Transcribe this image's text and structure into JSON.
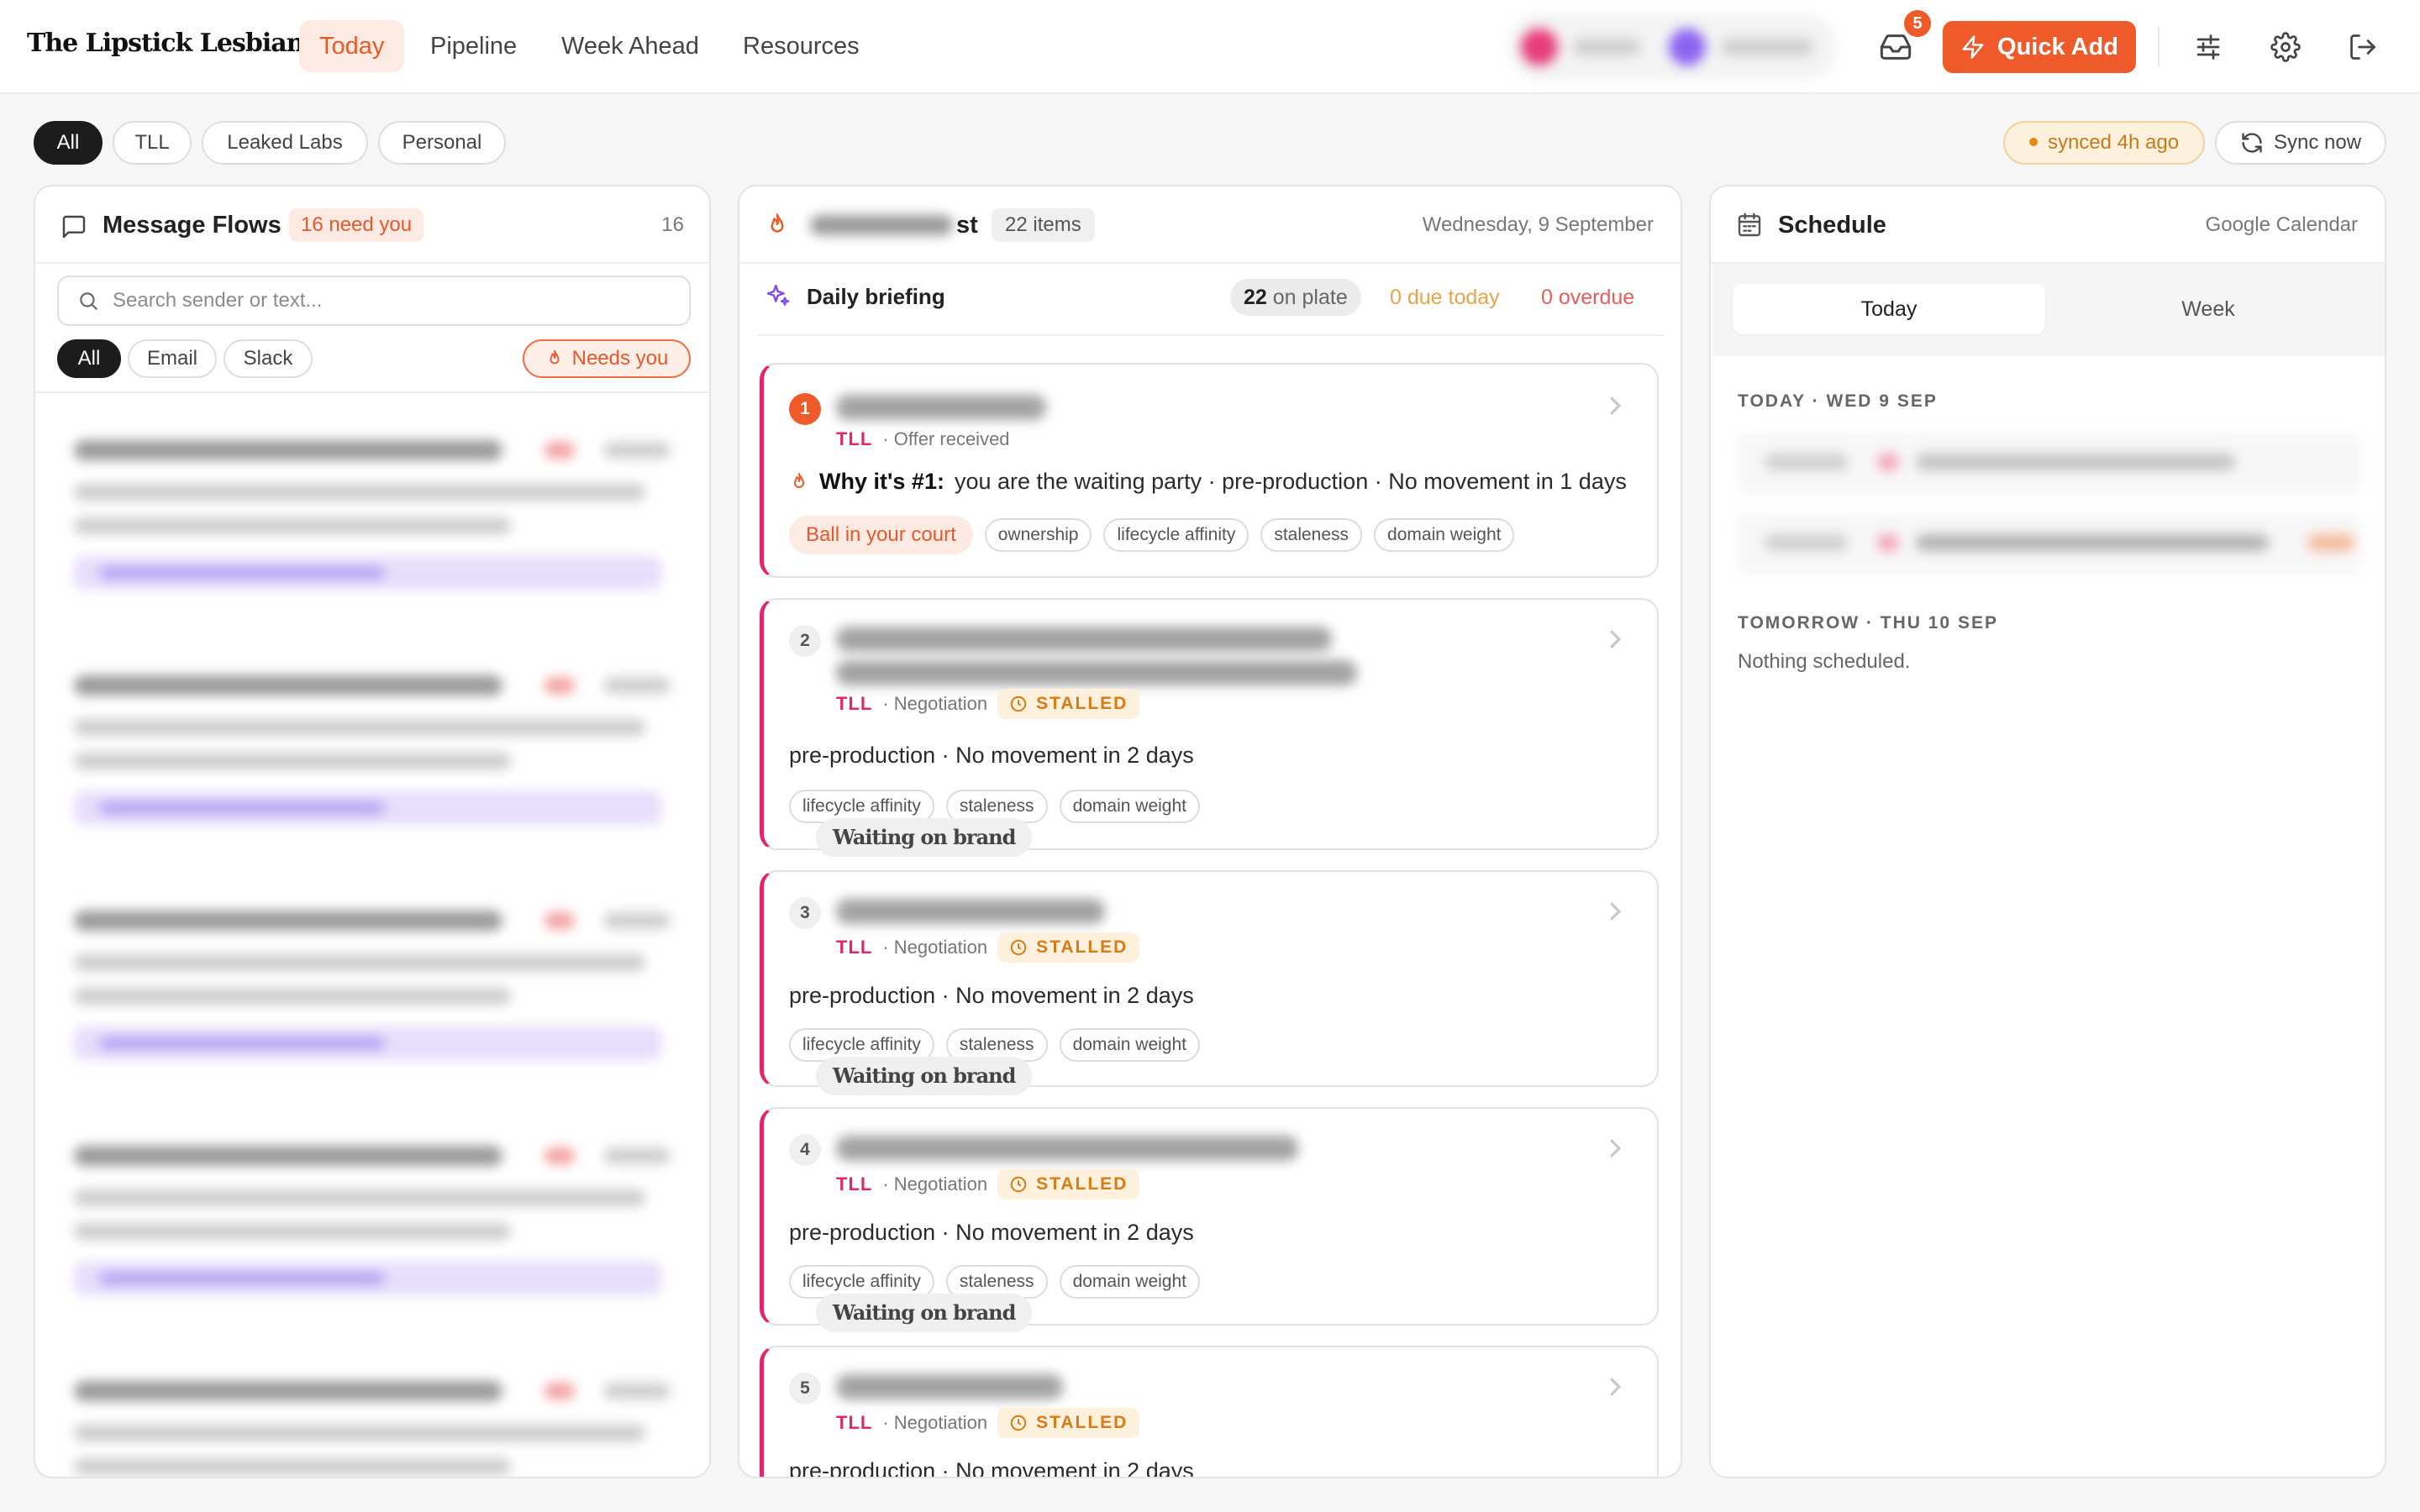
{
  "brand": "The Lipstick Lesbians",
  "nav": {
    "today": "Today",
    "pipeline": "Pipeline",
    "week_ahead": "Week Ahead",
    "resources": "Resources"
  },
  "inbox_badge": "5",
  "quick_add": "Quick Add",
  "filters": {
    "all": "All",
    "tll": "TLL",
    "leaked": "Leaked Labs",
    "personal": "Personal"
  },
  "sync": {
    "status": "synced 4h ago",
    "button": "Sync now"
  },
  "messages": {
    "title": "Message Flows",
    "need_badge": "16 need you",
    "count": "16",
    "search_placeholder": "Search sender or text...",
    "chips": {
      "all": "All",
      "email": "Email",
      "slack": "Slack",
      "needs": "Needs you"
    }
  },
  "focus": {
    "title_suffix": "st",
    "items": "22 items",
    "date": "Wednesday, 9 September",
    "briefing": "Daily briefing",
    "on_plate_num": "22",
    "on_plate_label": "on plate",
    "due_today": "0 due today",
    "overdue": "0 overdue",
    "cards": [
      {
        "num": "1",
        "tag": "TLL",
        "stage": "· Offer received",
        "why": "Why it's #1:",
        "reason": "you are the waiting party · pre-production · No movement in 1 days",
        "primary": "Ball in your court",
        "t1": "ownership",
        "t2": "lifecycle affinity",
        "t3": "staleness",
        "t4": "domain weight"
      },
      {
        "num": "2",
        "tag": "TLL",
        "stage": "· Negotiation",
        "status": "STALLED",
        "reason": "pre-production · No movement in 2 days",
        "primary": "Waiting on brand",
        "t1": "lifecycle affinity",
        "t2": "staleness",
        "t3": "domain weight"
      },
      {
        "num": "3",
        "tag": "TLL",
        "stage": "· Negotiation",
        "status": "STALLED",
        "reason": "pre-production · No movement in 2 days",
        "primary": "Waiting on brand",
        "t1": "lifecycle affinity",
        "t2": "staleness",
        "t3": "domain weight"
      },
      {
        "num": "4",
        "tag": "TLL",
        "stage": "· Negotiation",
        "status": "STALLED",
        "reason": "pre-production · No movement in 2 days",
        "primary": "Waiting on brand",
        "t1": "lifecycle affinity",
        "t2": "staleness",
        "t3": "domain weight"
      },
      {
        "num": "5",
        "tag": "TLL",
        "stage": "· Negotiation",
        "status": "STALLED",
        "reason": "pre-production · No movement in 2 days"
      }
    ]
  },
  "schedule": {
    "title": "Schedule",
    "source": "Google Calendar",
    "tab_today": "Today",
    "tab_week": "Week",
    "today_label": "TODAY · WED 9 SEP",
    "tomorrow_label": "TOMORROW · THU 10 SEP",
    "tomorrow_empty": "Nothing scheduled."
  },
  "colors": {
    "accent": "#ef5a2a",
    "deal": "#e3266c",
    "stalled": "#d97b14",
    "synced": "#c77a18"
  }
}
